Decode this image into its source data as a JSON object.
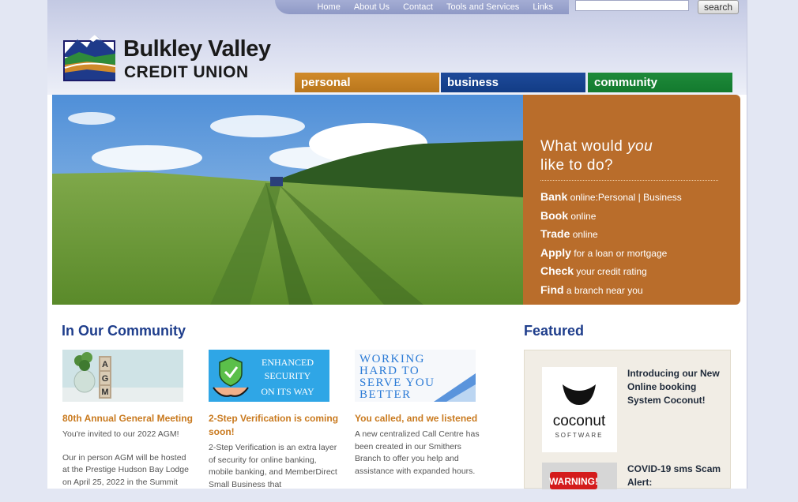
{
  "topnav": {
    "links": [
      "Home",
      "About Us",
      "Contact",
      "Tools and Services",
      "Links"
    ],
    "search_button": "search"
  },
  "logo": {
    "title": "Bulkley Valley",
    "subtitle": "CREDIT UNION"
  },
  "tabs": [
    "personal",
    "business",
    "community"
  ],
  "hero_panel": {
    "heading_line1_prefix": "What would ",
    "heading_line1_em": "you",
    "heading_line2": "like to do?",
    "items": [
      {
        "strong": "Bank",
        "rest": " online:Personal | Business"
      },
      {
        "strong": "Book",
        "rest": " online"
      },
      {
        "strong": "Trade",
        "rest": " online"
      },
      {
        "strong": "Apply",
        "rest": " for a loan or mortgage"
      },
      {
        "strong": "Check",
        "rest": " your credit rating"
      },
      {
        "strong": "Find",
        "rest": " a branch near you"
      }
    ]
  },
  "community": {
    "title": "In Our Community",
    "cards": [
      {
        "thumb_text": "AGM",
        "title": "80th Annual General Meeting",
        "paragraphs": [
          "You're invited to our 2022 AGM!",
          "Our in person AGM will be hosted at the Prestige Hudson Bay Lodge on April 25, 2022 in the Summit"
        ]
      },
      {
        "thumb_text": "ENHANCED SECURITY ON ITS WAY",
        "title": "2-Step Verification is coming soon!",
        "paragraphs": [
          "2-Step Verification is an extra layer of security for online banking, mobile banking, and MemberDirect Small Business that"
        ]
      },
      {
        "thumb_text": "WORKING HARD TO SERVE YOU BETTER",
        "title": "You called, and we listened",
        "paragraphs": [
          "A new centralized Call Centre has been created in our Smithers Branch to offer you help and assistance with expanded hours."
        ]
      }
    ]
  },
  "featured": {
    "title": "Featured",
    "items": [
      {
        "logo_text": "coconut",
        "logo_sub": "SOFTWARE",
        "text": "Introducing our New Online booking System Coconut!"
      },
      {
        "logo_text": "WARNING!",
        "text": "COVID-19 sms Scam Alert:"
      }
    ]
  },
  "colors": {
    "nav_blue": "#8f99c6",
    "tab_personal": "#c07d22",
    "tab_business": "#163f8a",
    "tab_community": "#168232",
    "panel_orange": "#b96d2b",
    "heading_blue": "#1f3e8c",
    "card_title_orange": "#c97a1f"
  }
}
